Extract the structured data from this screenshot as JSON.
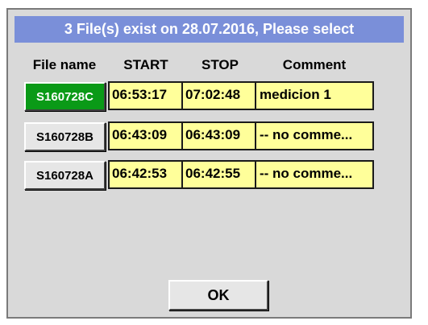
{
  "dialog": {
    "title": "3 File(s) exist on 28.07.2016, Please select",
    "title_color": "#7a8fd9"
  },
  "columns": {
    "file_name": "File name",
    "start": "START",
    "stop": "STOP",
    "comment": "Comment"
  },
  "files": [
    {
      "name": "S160728C",
      "start": "06:53:17",
      "stop": "07:02:48",
      "comment": "medicion 1",
      "selected": true
    },
    {
      "name": "S160728B",
      "start": "06:43:09",
      "stop": "06:43:09",
      "comment": "-- no comme...",
      "selected": false
    },
    {
      "name": "S160728A",
      "start": "06:42:53",
      "stop": "06:42:55",
      "comment": "-- no comme...",
      "selected": false
    }
  ],
  "ok_label": "OK",
  "colors": {
    "selected_button": "#0a9a17",
    "cell_background": "#ffff9a",
    "dialog_background": "#d9d9d9"
  }
}
